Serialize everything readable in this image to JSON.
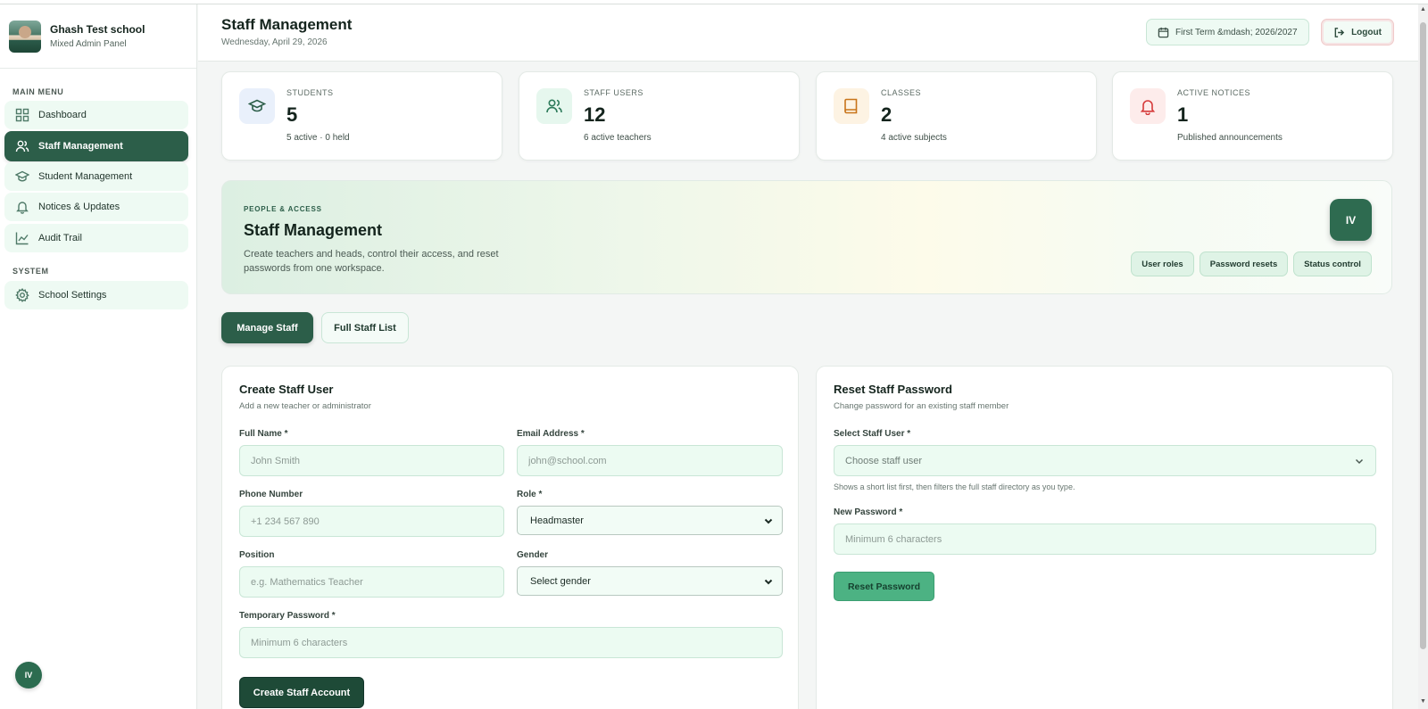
{
  "sidebar": {
    "school_name": "Ghash Test school",
    "school_sub": "Mixed Admin Panel",
    "main_menu_label": "MAIN MENU",
    "system_label": "SYSTEM",
    "items": [
      {
        "label": "Dashboard",
        "icon": "grid-icon"
      },
      {
        "label": "Staff Management",
        "icon": "users-icon",
        "active": true
      },
      {
        "label": "Student Management",
        "icon": "graduation-cap-icon"
      },
      {
        "label": "Notices & Updates",
        "icon": "bell-icon"
      },
      {
        "label": "Audit Trail",
        "icon": "chart-line-icon"
      }
    ],
    "system_items": [
      {
        "label": "School Settings",
        "icon": "gear-icon"
      }
    ],
    "avatar_initials": "IV"
  },
  "header": {
    "title": "Staff Management",
    "date": "Wednesday, April 29, 2026",
    "term": "First Term &mdash; 2026/2027",
    "logout": "Logout"
  },
  "stats": [
    {
      "label": "STUDENTS",
      "value": "5",
      "sub": "5 active · 0 held",
      "icon": "graduation-cap-icon",
      "color": "#2c5e49",
      "bg": "#e9f0fb"
    },
    {
      "label": "STAFF USERS",
      "value": "12",
      "sub": "6 active teachers",
      "icon": "users-icon",
      "color": "#2c7a5a",
      "bg": "#e6f7ee"
    },
    {
      "label": "CLASSES",
      "value": "2",
      "sub": "4 active subjects",
      "icon": "book-icon",
      "color": "#c8741a",
      "bg": "#fdf3e3"
    },
    {
      "label": "ACTIVE NOTICES",
      "value": "1",
      "sub": "Published announcements",
      "icon": "bell-icon",
      "color": "#d63a3a",
      "bg": "#fdeceb"
    }
  ],
  "hero": {
    "kicker": "PEOPLE & ACCESS",
    "title": "Staff Management",
    "description": "Create teachers and heads, control their access, and reset passwords from one workspace.",
    "avatar": "IV",
    "chips": [
      "User roles",
      "Password resets",
      "Status control"
    ]
  },
  "tabs": {
    "manage": "Manage Staff",
    "list": "Full Staff List"
  },
  "create_form": {
    "title": "Create Staff User",
    "subtitle": "Add a new teacher or administrator",
    "full_name_label": "Full Name *",
    "full_name_placeholder": "John Smith",
    "email_label": "Email Address *",
    "email_placeholder": "john@school.com",
    "phone_label": "Phone Number",
    "phone_placeholder": "+1 234 567 890",
    "role_label": "Role *",
    "role_value": "Headmaster",
    "position_label": "Position",
    "position_placeholder": "e.g. Mathematics Teacher",
    "gender_label": "Gender",
    "gender_value": "Select gender",
    "temp_password_label": "Temporary Password *",
    "temp_password_placeholder": "Minimum 6 characters",
    "submit": "Create Staff Account"
  },
  "reset_form": {
    "title": "Reset Staff Password",
    "subtitle": "Change password for an existing staff member",
    "select_label": "Select Staff User *",
    "select_placeholder": "Choose staff user",
    "select_hint": "Shows a short list first, then filters the full staff directory as you type.",
    "new_password_label": "New Password *",
    "new_password_placeholder": "Minimum 6 characters",
    "submit": "Reset Password"
  }
}
